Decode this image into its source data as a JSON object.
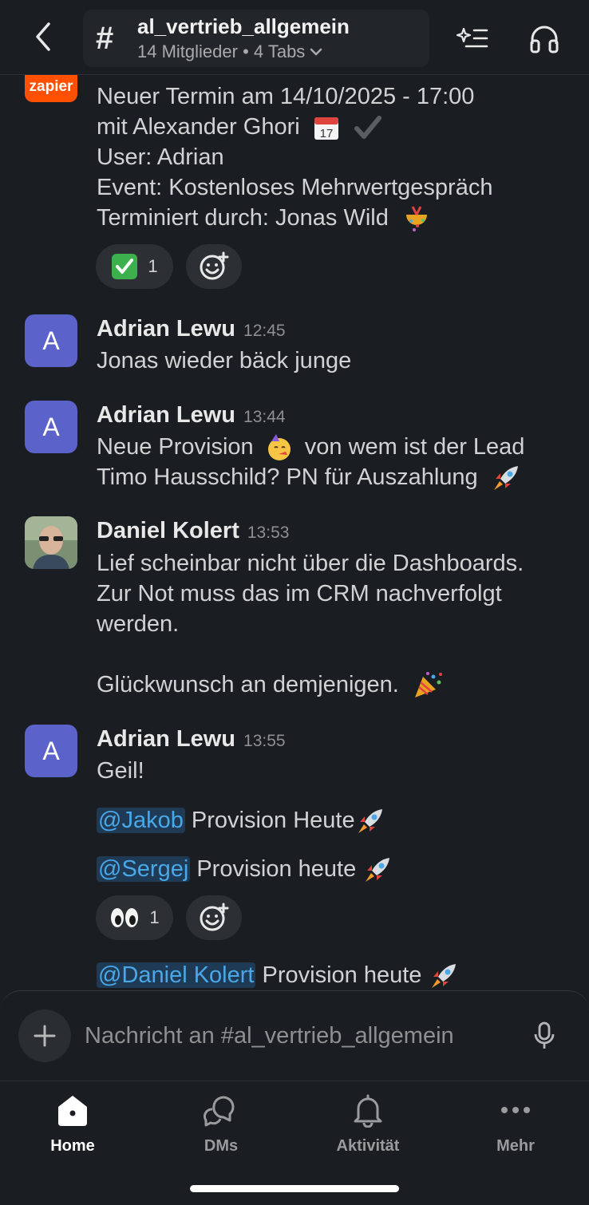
{
  "header": {
    "channel_name": "al_vertrieb_allgemein",
    "meta": "14 Mitglieder • 4 Tabs"
  },
  "messages": [
    {
      "app": "zapier",
      "lines": [
        "Neuer Termin am 14/10/2025 - 17:00",
        "mit Alexander Ghori",
        "User: Adrian",
        "Event: Kostenloses Mehrwertgespräch",
        "Terminiert durch: Jonas Wild"
      ],
      "reaction_count": "1"
    },
    {
      "avatar": "A",
      "author": "Adrian Lewu",
      "time": "12:45",
      "lines": [
        "Jonas wieder bäck junge"
      ]
    },
    {
      "avatar": "A",
      "author": "Adrian Lewu",
      "time": "13:44",
      "line1a": "Neue Provision",
      "line1b": "von wem ist der Lead",
      "line2": "Timo Hausschild? PN für Auszahlung"
    },
    {
      "author": "Daniel Kolert",
      "time": "13:53",
      "lines": [
        "Lief scheinbar nicht über die Dashboards.",
        "Zur Not muss das im CRM nachverfolgt",
        "werden.",
        "Glückwunsch an demjenigen."
      ]
    },
    {
      "avatar": "A",
      "author": "Adrian Lewu",
      "time": "13:55",
      "text": "Geil!",
      "mention1": "@Jakob",
      "text1": "Provision Heute",
      "mention2": "@Sergej",
      "text2": "Provision heute",
      "reaction_count": "1",
      "mention3": "@Daniel Kolert",
      "text3": "Provision heute"
    }
  ],
  "composer": {
    "placeholder": "Nachricht an #al_vertrieb_allgemein"
  },
  "nav": {
    "home": "Home",
    "dms": "DMs",
    "activity": "Aktivität",
    "more": "Mehr"
  }
}
